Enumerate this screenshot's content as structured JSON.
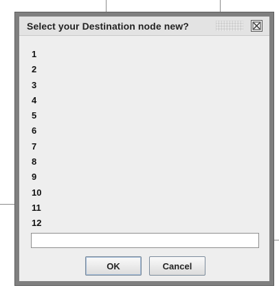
{
  "dialog": {
    "title": "Select your Destination node new?",
    "close_icon": "close-icon"
  },
  "options": [
    "1",
    "2",
    "3",
    "4",
    "5",
    "6",
    "7",
    "8",
    "9",
    "10",
    "11",
    "12"
  ],
  "input": {
    "value": ""
  },
  "buttons": {
    "ok": "OK",
    "cancel": "Cancel"
  },
  "colors": {
    "border": "#7f7f7f",
    "panel": "#eeeeee",
    "focus": "#9fb7d4"
  }
}
